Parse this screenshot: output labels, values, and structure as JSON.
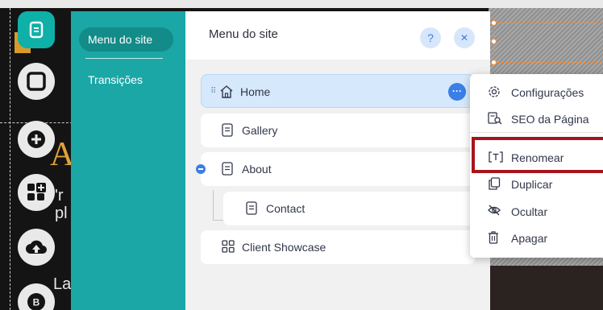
{
  "teal_menu": {
    "items": [
      {
        "label": "Menu do site",
        "selected": true
      },
      {
        "label": "Transições",
        "selected": false
      }
    ]
  },
  "pages_panel": {
    "title": "Menu do site",
    "help_label": "?",
    "close_label": "✕",
    "pages": [
      {
        "label": "Home",
        "icon": "home-icon",
        "highlighted": true
      },
      {
        "label": "Gallery",
        "icon": "page-icon"
      },
      {
        "label": "About",
        "icon": "page-icon",
        "expanded": true
      },
      {
        "label": "Contact",
        "icon": "page-icon",
        "subpage": true
      },
      {
        "label": "Client Showcase",
        "icon": "grid-page-icon"
      }
    ],
    "more_label": "···"
  },
  "context_menu": {
    "items": [
      {
        "label": "Configurações",
        "icon": "gear-icon"
      },
      {
        "label": "SEO da Página",
        "icon": "seo-search-icon"
      },
      {
        "label": "Renomear",
        "icon": "rename-icon",
        "highlighted": true
      },
      {
        "label": "Duplicar",
        "icon": "duplicate-icon"
      },
      {
        "label": "Ocultar",
        "icon": "hide-icon"
      },
      {
        "label": "Apagar",
        "icon": "trash-icon"
      }
    ]
  },
  "background": {
    "big_letter": "A",
    "fragments": [
      "'r",
      "pl",
      "La"
    ]
  },
  "toolbar": {
    "badge_letter": "B",
    "icons": [
      "pages-icon",
      "square-icon",
      "add-icon",
      "add-apps-icon",
      "upload-icon",
      "blog-icon"
    ]
  },
  "colors": {
    "teal": "#1aa7a6",
    "teal_selected": "#138b89",
    "accent_blue": "#3a7ee6",
    "highlight_blue": "#d6e8fb",
    "annotation_red": "#a8141c",
    "selection_orange": "#ff8a2a"
  }
}
